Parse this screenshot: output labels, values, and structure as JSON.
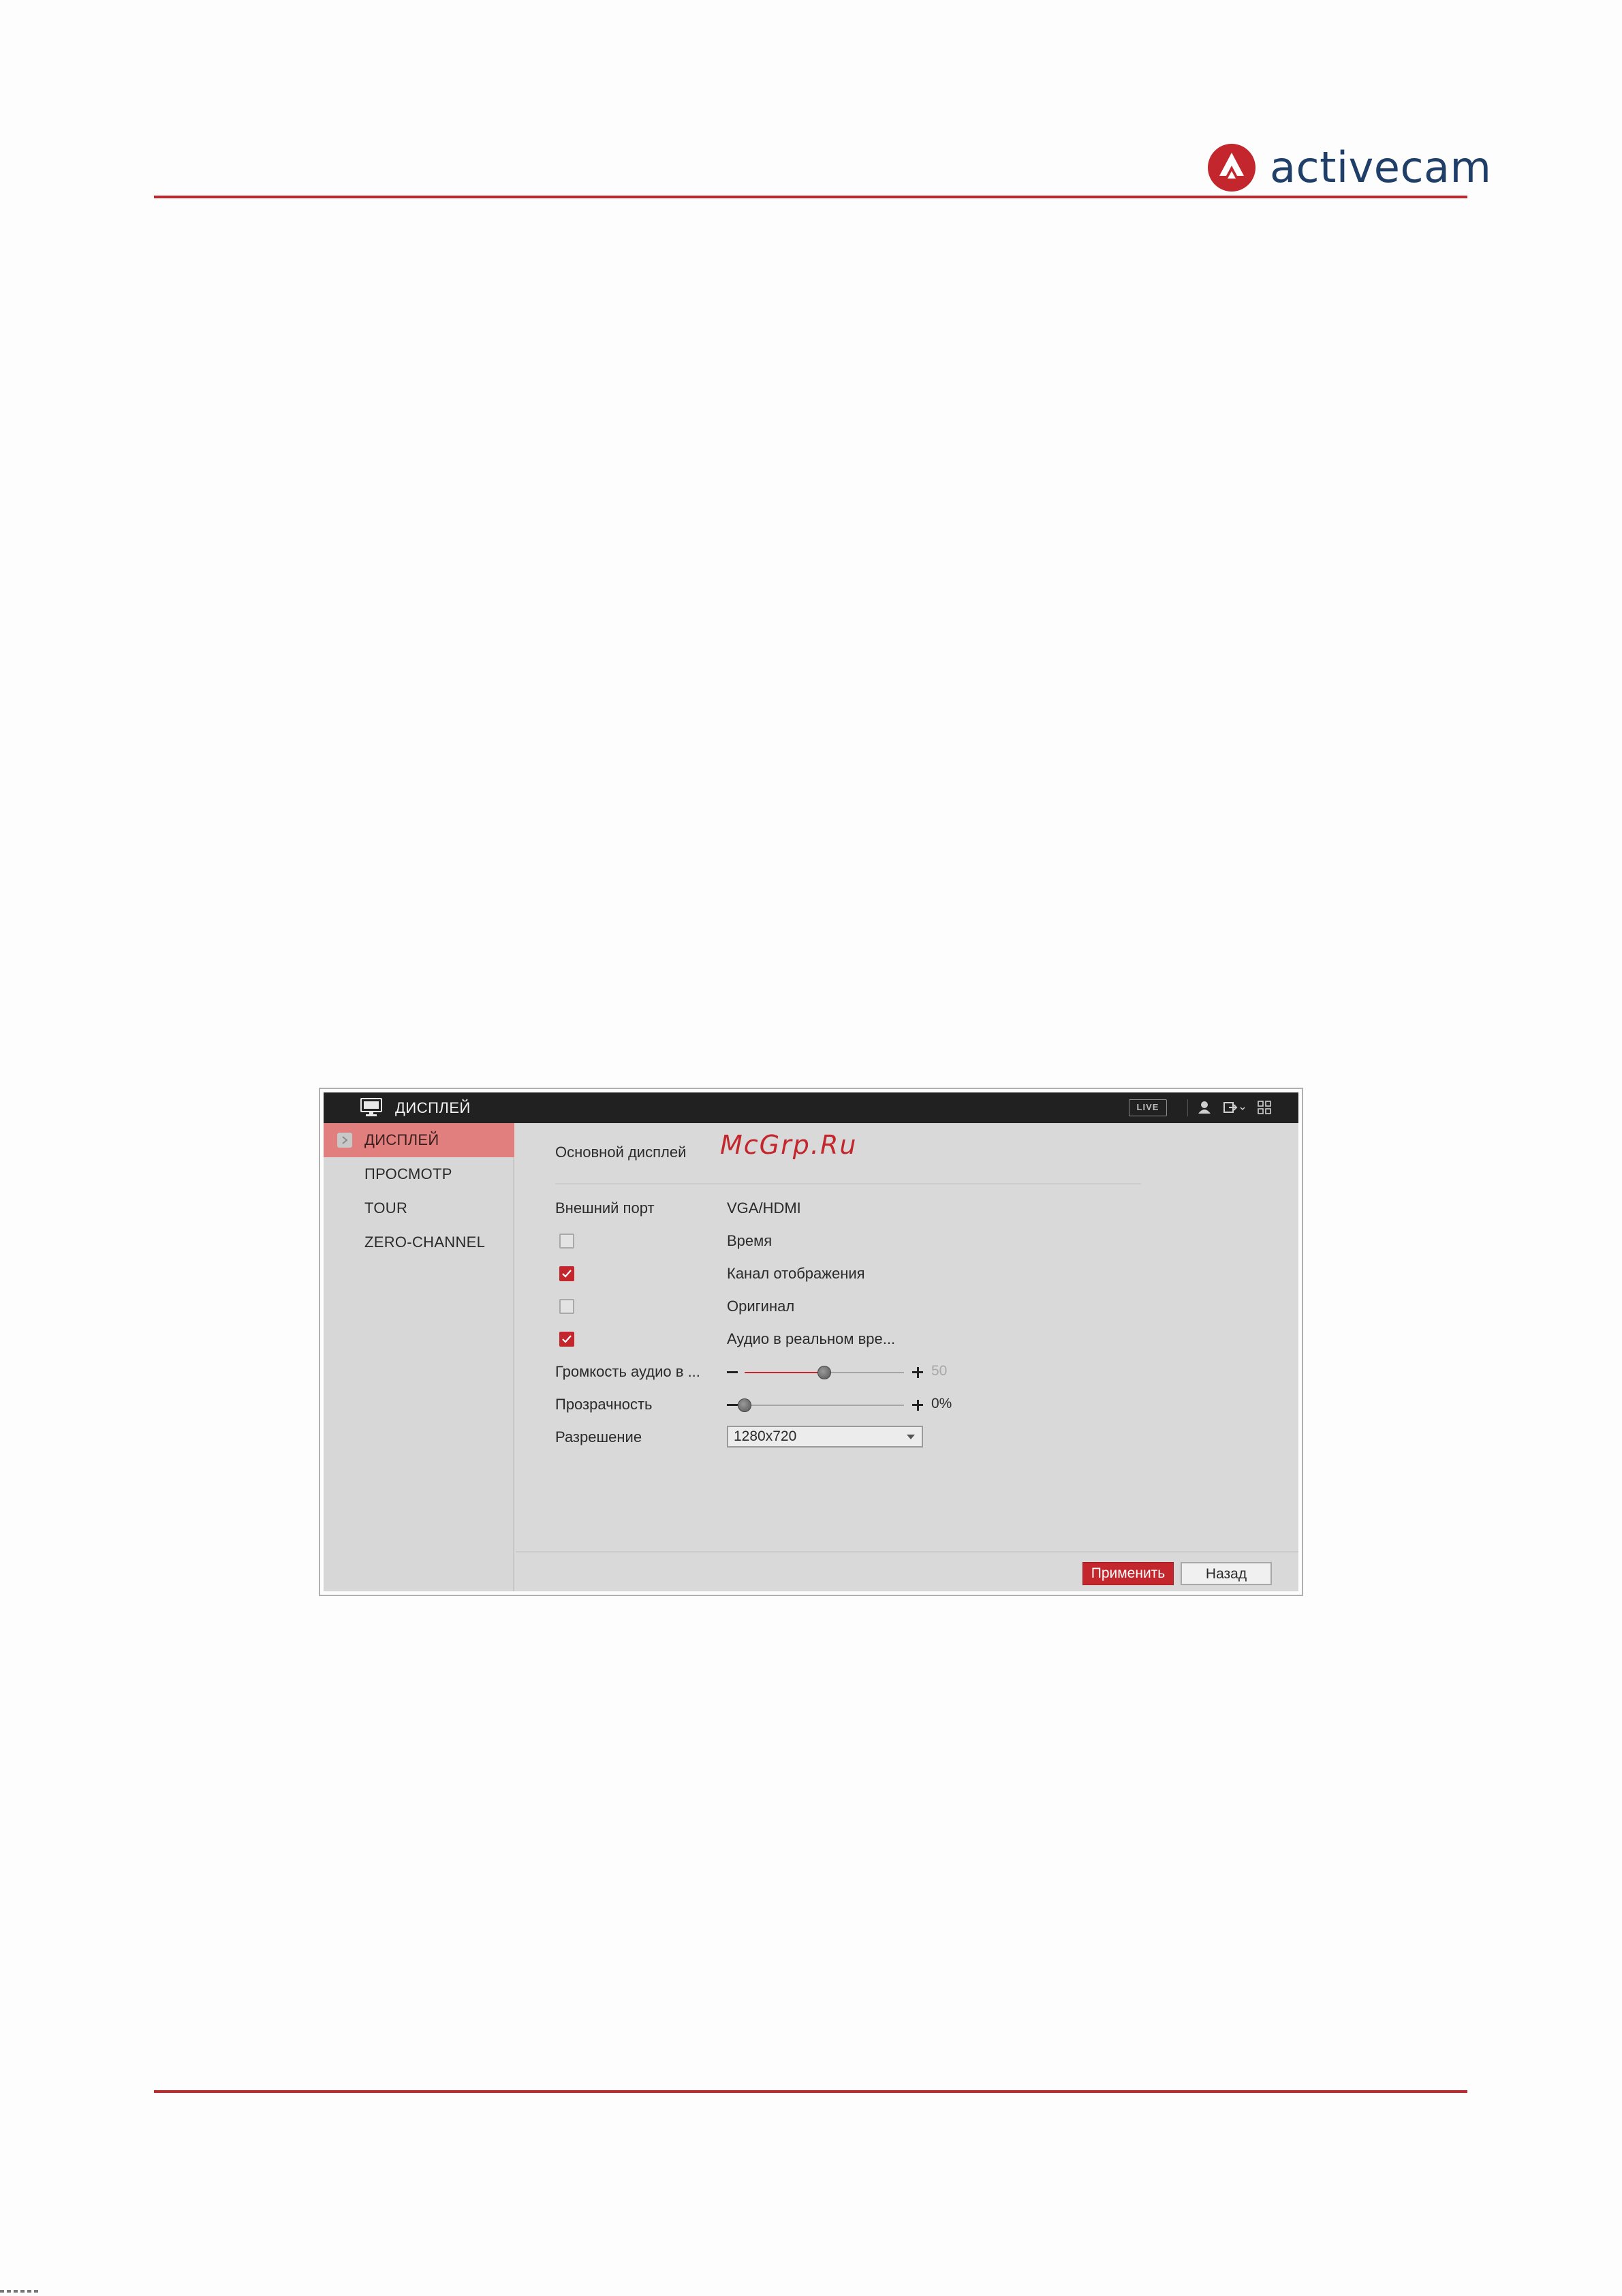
{
  "document": {
    "brand": "activecam"
  },
  "app": {
    "title": "ДИСПЛЕЙ",
    "live_label": "LIVE",
    "sidebar": {
      "items": [
        {
          "label": "ДИСПЛЕЙ",
          "active": true
        },
        {
          "label": "ПРОСМОТР",
          "active": false
        },
        {
          "label": "TOUR",
          "active": false
        },
        {
          "label": "ZERO-CHANNEL",
          "active": false
        }
      ]
    },
    "main": {
      "section_title": "Основной дисплей",
      "watermark": "McGrp.Ru",
      "output_port": {
        "label": "Внешний порт",
        "value": "VGA/HDMI"
      },
      "options": [
        {
          "label": "Время",
          "checked": false
        },
        {
          "label": "Канал отображения",
          "checked": true
        },
        {
          "label": "Оригинал",
          "checked": false
        },
        {
          "label": "Аудио в реальном вре...",
          "checked": true
        }
      ],
      "volume": {
        "label": "Громкость аудио в ...",
        "value": 50,
        "value_text": "50",
        "max": 100
      },
      "transparency": {
        "label": "Прозрачность",
        "value": 0,
        "value_text": "0%",
        "max": 100
      },
      "resolution": {
        "label": "Разрешение",
        "selected": "1280x720"
      }
    },
    "footer": {
      "apply_label": "Применить",
      "back_label": "Назад"
    }
  },
  "colors": {
    "accent": "#c3262c",
    "titlebar": "#212121",
    "active_nav": "#e07f7d",
    "panel": "#d9d9d9",
    "brand_text": "#1f3f68"
  },
  "icons": [
    "activecam-logo",
    "monitor-icon",
    "user-icon",
    "logout-icon",
    "grid-menu-icon",
    "chevron-right-icon",
    "checkmark-icon",
    "dropdown-arrow-icon"
  ]
}
